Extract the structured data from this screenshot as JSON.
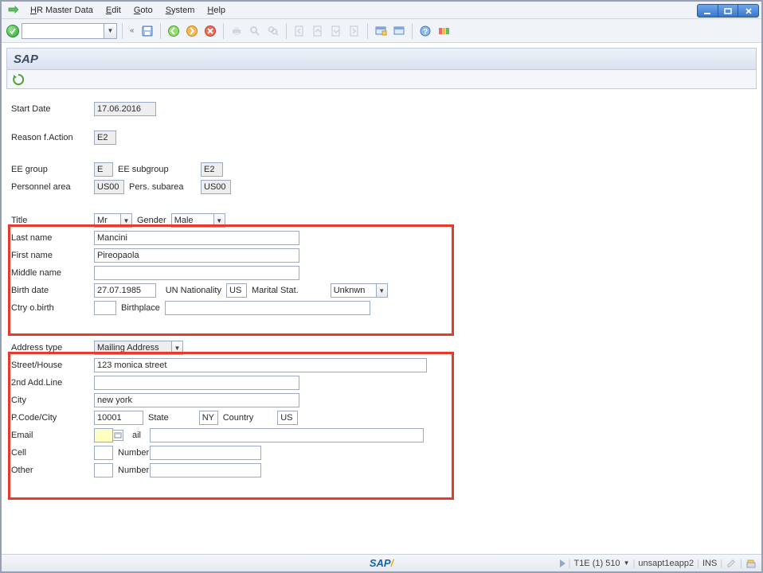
{
  "menu": {
    "items": [
      "HR Master Data",
      "Edit",
      "Goto",
      "System",
      "Help"
    ]
  },
  "banner": {
    "text": "SAP"
  },
  "fields": {
    "start_date_label": "Start Date",
    "start_date": "17.06.2016",
    "reason_label": "Reason f.Action",
    "reason": "E2",
    "ee_group_label": "EE group",
    "ee_group": "E",
    "ee_subgroup_label": "EE subgroup",
    "ee_subgroup": "E2",
    "personnel_area_label": "Personnel area",
    "personnel_area": "US00",
    "pers_subarea_label": "Pers. subarea",
    "pers_subarea": "US00",
    "title_label": "Title",
    "title": "Mr",
    "gender_label": "Gender",
    "gender": "Male",
    "last_name_label": "Last name",
    "last_name": "Mancini",
    "first_name_label": "First name",
    "first_name": "Pireopaola",
    "middle_name_label": "Middle name",
    "middle_name": "",
    "birth_date_label": "Birth date",
    "birth_date": "27.07.1985",
    "un_nat_label": "UN Nationality",
    "un_nat": "US",
    "marital_label": "Marital Stat.",
    "marital": "Unknwn",
    "ctry_birth_label": "Ctry o.birth",
    "ctry_birth": "",
    "birthplace_label": "Birthplace",
    "birthplace": "",
    "addr_type_label": "Address type",
    "addr_type": "Mailing Address",
    "street_label": "Street/House",
    "street": "123 monica street",
    "line2_label": "2nd Add.Line",
    "line2": "",
    "city_label": "City",
    "city": "new york",
    "pcode_label": "P.Code/City",
    "pcode": "10001",
    "state_label": "State",
    "state": "NY",
    "country_label": "Country",
    "country": "US",
    "email_label": "Email",
    "email_code": "",
    "mail_sublabel": "ail",
    "email": "",
    "cell_label": "Cell",
    "cell_code": "",
    "number_sublabel": "Number",
    "cell_num": "",
    "other_label": "Other",
    "other_code": "",
    "other_num": ""
  },
  "status": {
    "session": "T1E (1) 510",
    "server": "unsapt1eapp2",
    "mode": "INS"
  }
}
